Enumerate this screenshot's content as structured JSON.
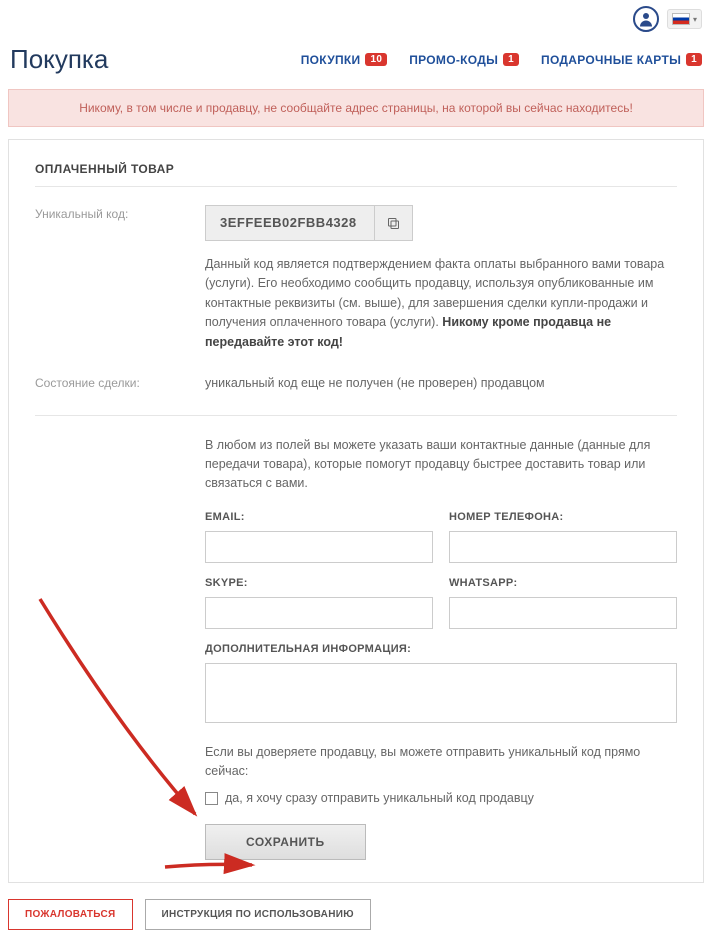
{
  "header": {
    "title": "Покупка",
    "tabs": [
      {
        "label": "ПОКУПКИ",
        "count": "10"
      },
      {
        "label": "ПРОМО-КОДЫ",
        "count": "1"
      },
      {
        "label": "ПОДАРОЧНЫЕ КАРТЫ",
        "count": "1"
      }
    ]
  },
  "warning": "Никому, в том числе и продавцу, не сообщайте адрес страницы, на которой вы сейчас находитесь!",
  "section": {
    "title": "ОПЛАЧЕННЫЙ ТОВАР",
    "code_label": "Уникальный код:",
    "code_value": "3EFFEEB02FBB4328",
    "code_desc_1": "Данный код является подтверждением факта оплаты выбранного вами товара (услуги). Его необходимо сообщить продавцу, используя опубликованные им контактные реквизиты (см. выше), для завершения сделки купли-продажи и получения оплаченного товара (услуги). ",
    "code_desc_bold": "Никому кроме продавца не передавайте этот код!",
    "status_label": "Состояние сделки:",
    "status_value": "уникальный код еще не получен (не проверен) продавцом"
  },
  "contact": {
    "intro": "В любом из полей вы можете указать ваши контактные данные (данные для передачи товара), которые помогут продавцу быстрее доставить товар или связаться с вами.",
    "email_label": "EMAIL:",
    "phone_label": "НОМЕР ТЕЛЕФОНА:",
    "skype_label": "SKYPE:",
    "whatsapp_label": "WHATSAPP:",
    "extra_label": "ДОПОЛНИТЕЛЬНАЯ ИНФОРМАЦИЯ:",
    "trust_text": "Если вы доверяете продавцу, вы можете отправить уникальный код прямо сейчас:",
    "checkbox_label": "да, я хочу сразу отправить уникальный код продавцу",
    "save_label": "СОХРАНИТЬ"
  },
  "footer": {
    "complain": "ПОЖАЛОВАТЬСЯ",
    "instructions": "ИНСТРУКЦИЯ ПО ИСПОЛЬЗОВАНИЮ"
  }
}
